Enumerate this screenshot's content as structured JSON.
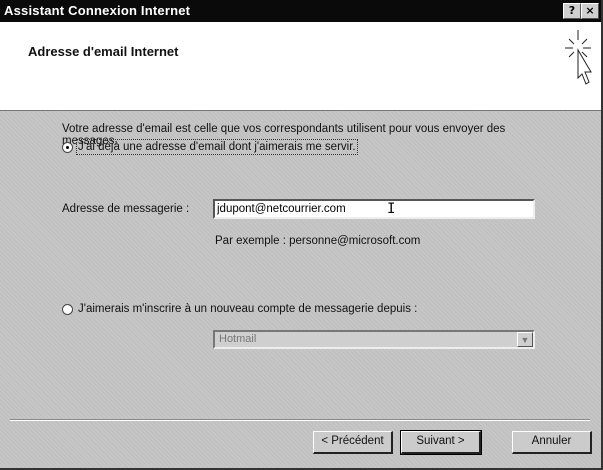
{
  "window": {
    "title": "Assistant Connexion Internet",
    "help_glyph": "?",
    "close_glyph": "×"
  },
  "header": {
    "title": "Adresse d'email Internet",
    "icon": "wizard-wand-icon"
  },
  "main": {
    "description": "Votre adresse d'email est celle que vos correspondants utilisent pour vous envoyer des messages.",
    "option_existing": {
      "label": "J'ai déjà une adresse d'email dont j'aimerais me servir.",
      "checked": true
    },
    "email_field": {
      "label": "Adresse de messagerie :",
      "value": "jdupont@netcourrier.com"
    },
    "example": "Par exemple : personne@microsoft.com",
    "option_new": {
      "label": "J'aimerais m'inscrire à un nouveau compte de messagerie depuis :",
      "checked": false
    },
    "provider_select": {
      "value": "Hotmail",
      "disabled": true
    }
  },
  "buttons": {
    "previous": "< Précédent",
    "next": "Suivant >",
    "cancel": "Annuler"
  }
}
